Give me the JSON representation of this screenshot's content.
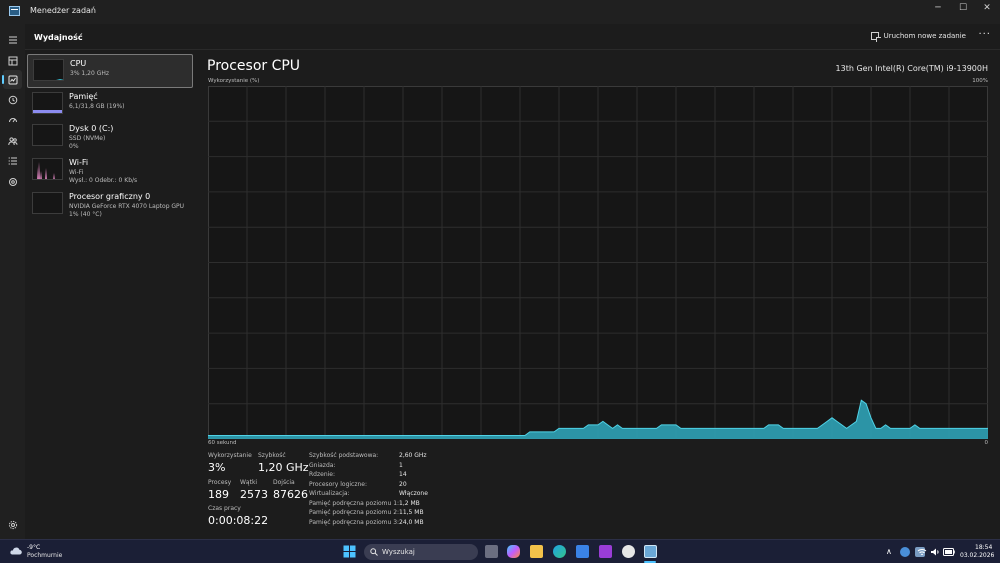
{
  "window": {
    "title": "Menedżer zadań",
    "minimize": "─",
    "maximize": "☐",
    "close": "✕"
  },
  "commandbar": {
    "section_title": "Wydajność",
    "run_new_task": "Uruchom nowe zadanie",
    "more": "···"
  },
  "nav": {
    "items": [
      "menu-icon",
      "processes-icon",
      "performance-icon",
      "app-history-icon",
      "startup-icon",
      "users-icon",
      "details-icon",
      "services-icon"
    ],
    "settings": "settings-icon"
  },
  "devices": [
    {
      "name": "CPU",
      "line1": "3%  1,20 GHz",
      "line2": "",
      "color": "#33b8cc"
    },
    {
      "name": "Pamięć",
      "line1": "6,1/31,8 GB (19%)",
      "line2": "",
      "color": "#8c8cf0"
    },
    {
      "name": "Dysk 0 (C:)",
      "line1": "SSD (NVMe)",
      "line2": "0%",
      "color": "#8cc63f"
    },
    {
      "name": "Wi-Fi",
      "line1": "Wi-Fi",
      "line2": "Wysł.: 0  Odebr.: 0 Kb/s",
      "color": "#e88bc7"
    },
    {
      "name": "Procesor graficzny 0",
      "line1": "NVIDIA GeForce RTX 4070 Laptop GPU",
      "line2": "1%  (40 °C)",
      "color": "#7f9ad6"
    }
  ],
  "main": {
    "title": "Procesor CPU",
    "model": "13th Gen Intel(R) Core(TM) i9-13900H",
    "util_label": "Wykorzystanie (%)",
    "max_label": "100%",
    "time_label": "60 sekund",
    "min_label": "0",
    "graph_color": "#2fa2b6",
    "grid_color": "#2e2e2e"
  },
  "chart_data": {
    "type": "area",
    "x_label": "60 sekund",
    "y_label": "Wykorzystanie (%)",
    "ylim": [
      0,
      100
    ],
    "values": [
      1,
      1,
      1,
      1,
      1,
      1,
      1,
      1,
      1,
      1,
      1,
      1,
      1,
      1,
      1,
      1,
      1,
      1,
      1,
      1,
      1,
      1,
      1,
      1,
      1,
      1,
      1,
      1,
      1,
      1,
      1,
      1,
      1,
      1,
      1,
      1,
      1,
      1,
      1,
      1,
      1,
      1,
      1,
      1,
      1,
      1,
      1,
      1,
      1,
      1,
      1,
      1,
      1,
      1,
      1,
      1,
      1,
      1,
      1,
      1,
      1,
      1,
      1,
      1,
      1,
      1,
      2,
      2,
      2,
      2,
      2,
      2,
      3,
      3,
      3,
      3,
      3,
      3,
      4,
      4,
      4,
      5,
      4,
      3,
      4,
      3,
      3,
      3,
      3,
      3,
      3,
      3,
      3,
      4,
      4,
      4,
      4,
      3,
      3,
      3,
      3,
      3,
      3,
      3,
      3,
      3,
      3,
      3,
      3,
      3,
      3,
      3,
      3,
      3,
      3,
      4,
      4,
      4,
      3,
      3,
      3,
      3,
      3,
      3,
      3,
      3,
      4,
      5,
      6,
      5,
      4,
      3,
      4,
      5,
      11,
      10,
      6,
      3,
      3,
      4,
      3,
      3,
      3,
      3,
      3,
      4,
      3,
      3,
      3,
      3,
      3,
      3,
      3,
      3,
      3,
      3,
      3,
      3,
      3,
      3,
      3
    ]
  },
  "stats": {
    "util_lbl": "Wykorzystanie",
    "util_val": "3%",
    "speed_lbl": "Szybkość",
    "speed_val": "1,20 GHz",
    "proc_lbl": "Procesy",
    "proc_val": "189",
    "threads_lbl": "Wątki",
    "threads_val": "2573",
    "handles_lbl": "Dojścia",
    "handles_val": "87626",
    "uptime_lbl": "Czas pracy",
    "uptime_val": "0:00:08:22"
  },
  "info": [
    {
      "label": "Szybkość podstawowa:",
      "value": "2,60 GHz"
    },
    {
      "label": "Gniazda:",
      "value": "1"
    },
    {
      "label": "Rdzenie:",
      "value": "14"
    },
    {
      "label": "Procesory logiczne:",
      "value": "20"
    },
    {
      "label": "Wirtualizacja:",
      "value": "Włączone"
    },
    {
      "label": "Pamięć podręczna poziomu 1:",
      "value": "1,2 MB"
    },
    {
      "label": "Pamięć podręczna poziomu 2:",
      "value": "11,5 MB"
    },
    {
      "label": "Pamięć podręczna poziomu 3:",
      "value": "24,0 MB"
    }
  ],
  "taskbar": {
    "temp": "-9°C",
    "condition": "Pochmurnie",
    "search_placeholder": "Wyszukaj",
    "time": "18:54",
    "date": "03.02.2026",
    "chevron": "∧"
  }
}
